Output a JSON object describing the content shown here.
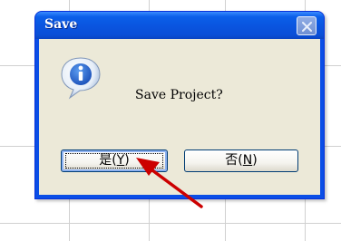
{
  "dialog": {
    "title": "Save",
    "message": "Save Project?",
    "yes_prefix": "是(",
    "yes_key": "Y",
    "yes_suffix": ")",
    "no_prefix": "否(",
    "no_key": "N",
    "no_suffix": ")"
  },
  "icons": {
    "info": "info-icon",
    "close": "close-icon",
    "pointer": "red-arrow-pointer"
  },
  "colors": {
    "titlebar": "#0a54df",
    "client": "#ece9d8",
    "arrow": "#cc0000",
    "info_icon": "#2a6bd8"
  }
}
